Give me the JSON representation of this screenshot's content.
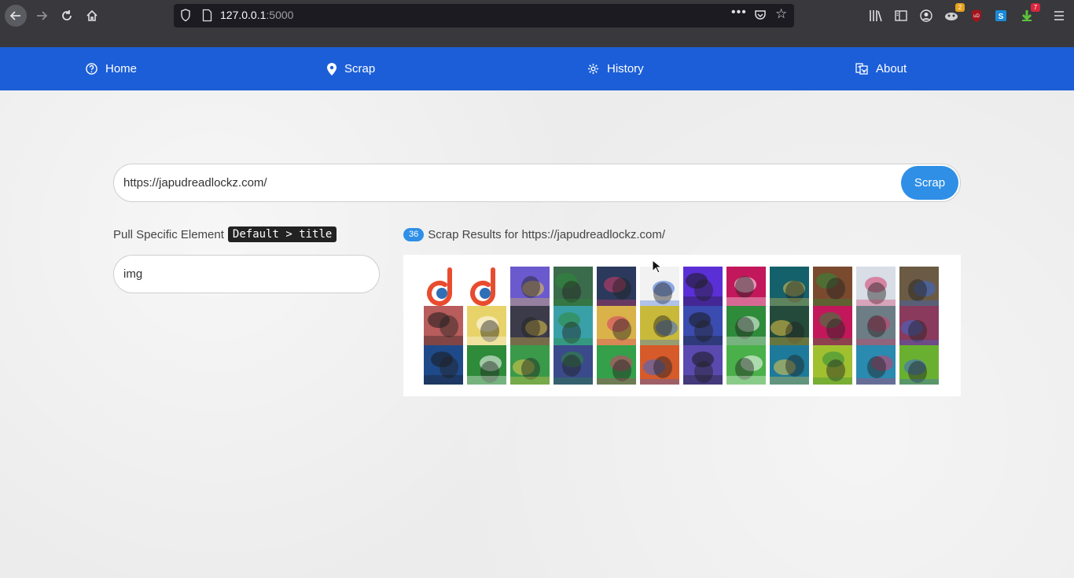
{
  "browser": {
    "url_host": "127.0.0.1",
    "url_port": ":5000",
    "badges": {
      "extension_a": "2",
      "downloads": "7"
    }
  },
  "nav": {
    "items": [
      {
        "label": "Home",
        "icon": "question-circle-icon"
      },
      {
        "label": "Scrap",
        "icon": "map-pin-icon"
      },
      {
        "label": "History",
        "icon": "gear-icon"
      },
      {
        "label": "About",
        "icon": "translate-icon"
      }
    ]
  },
  "search": {
    "url_value": "https://japudreadlockz.com/",
    "button_label": "Scrap"
  },
  "element_filter": {
    "label": "Pull Specific Element",
    "default_tag": "Default > title",
    "value": "img"
  },
  "results": {
    "count": "36",
    "heading": "Scrap Results for https://japudreadlockz.com/",
    "thumbnails": [
      {
        "kind": "logo",
        "color": "#e84c2f"
      },
      {
        "kind": "logo",
        "color": "#e84c2f"
      },
      {
        "kind": "photo",
        "color": "#6a5acd"
      },
      {
        "kind": "photo",
        "color": "#3a6b4a"
      },
      {
        "kind": "photo",
        "color": "#2b3a5c"
      },
      {
        "kind": "photo",
        "color": "#f2f2f2"
      },
      {
        "kind": "photo",
        "color": "#5b2fd6"
      },
      {
        "kind": "photo",
        "color": "#c2185b"
      },
      {
        "kind": "photo",
        "color": "#14606b"
      },
      {
        "kind": "photo",
        "color": "#7a4a2e"
      },
      {
        "kind": "photo",
        "color": "#d8dde6"
      },
      {
        "kind": "photo",
        "color": "#6b5a44"
      },
      {
        "kind": "photo",
        "color": "#b85c5c"
      },
      {
        "kind": "photo",
        "color": "#e8d36a"
      },
      {
        "kind": "photo",
        "color": "#3b3b4a"
      },
      {
        "kind": "photo",
        "color": "#3aa0a8"
      },
      {
        "kind": "photo",
        "color": "#d9b24a"
      },
      {
        "kind": "photo",
        "color": "#c9b93a"
      },
      {
        "kind": "photo",
        "color": "#3b4cb0"
      },
      {
        "kind": "photo",
        "color": "#2e8b3a"
      },
      {
        "kind": "photo",
        "color": "#234a3a"
      },
      {
        "kind": "photo",
        "color": "#c2185b"
      },
      {
        "kind": "photo",
        "color": "#6d7d86"
      },
      {
        "kind": "photo",
        "color": "#8a3a5c"
      },
      {
        "kind": "photo",
        "color": "#1f4a8a"
      },
      {
        "kind": "photo",
        "color": "#2e8b3a"
      },
      {
        "kind": "photo",
        "color": "#3a9a4a"
      },
      {
        "kind": "photo",
        "color": "#3a4a8a"
      },
      {
        "kind": "photo",
        "color": "#35a04a"
      },
      {
        "kind": "photo",
        "color": "#d65a2a"
      },
      {
        "kind": "photo",
        "color": "#5a4ab0"
      },
      {
        "kind": "photo",
        "color": "#4ab04a"
      },
      {
        "kind": "photo",
        "color": "#1d7a9a"
      },
      {
        "kind": "photo",
        "color": "#a0c030"
      },
      {
        "kind": "photo",
        "color": "#2a8ab0"
      },
      {
        "kind": "photo",
        "color": "#6ab030"
      }
    ]
  },
  "colors": {
    "nav_bg": "#1b5ed8",
    "accent": "#2f8fe6",
    "browser_bg": "#38383d"
  }
}
